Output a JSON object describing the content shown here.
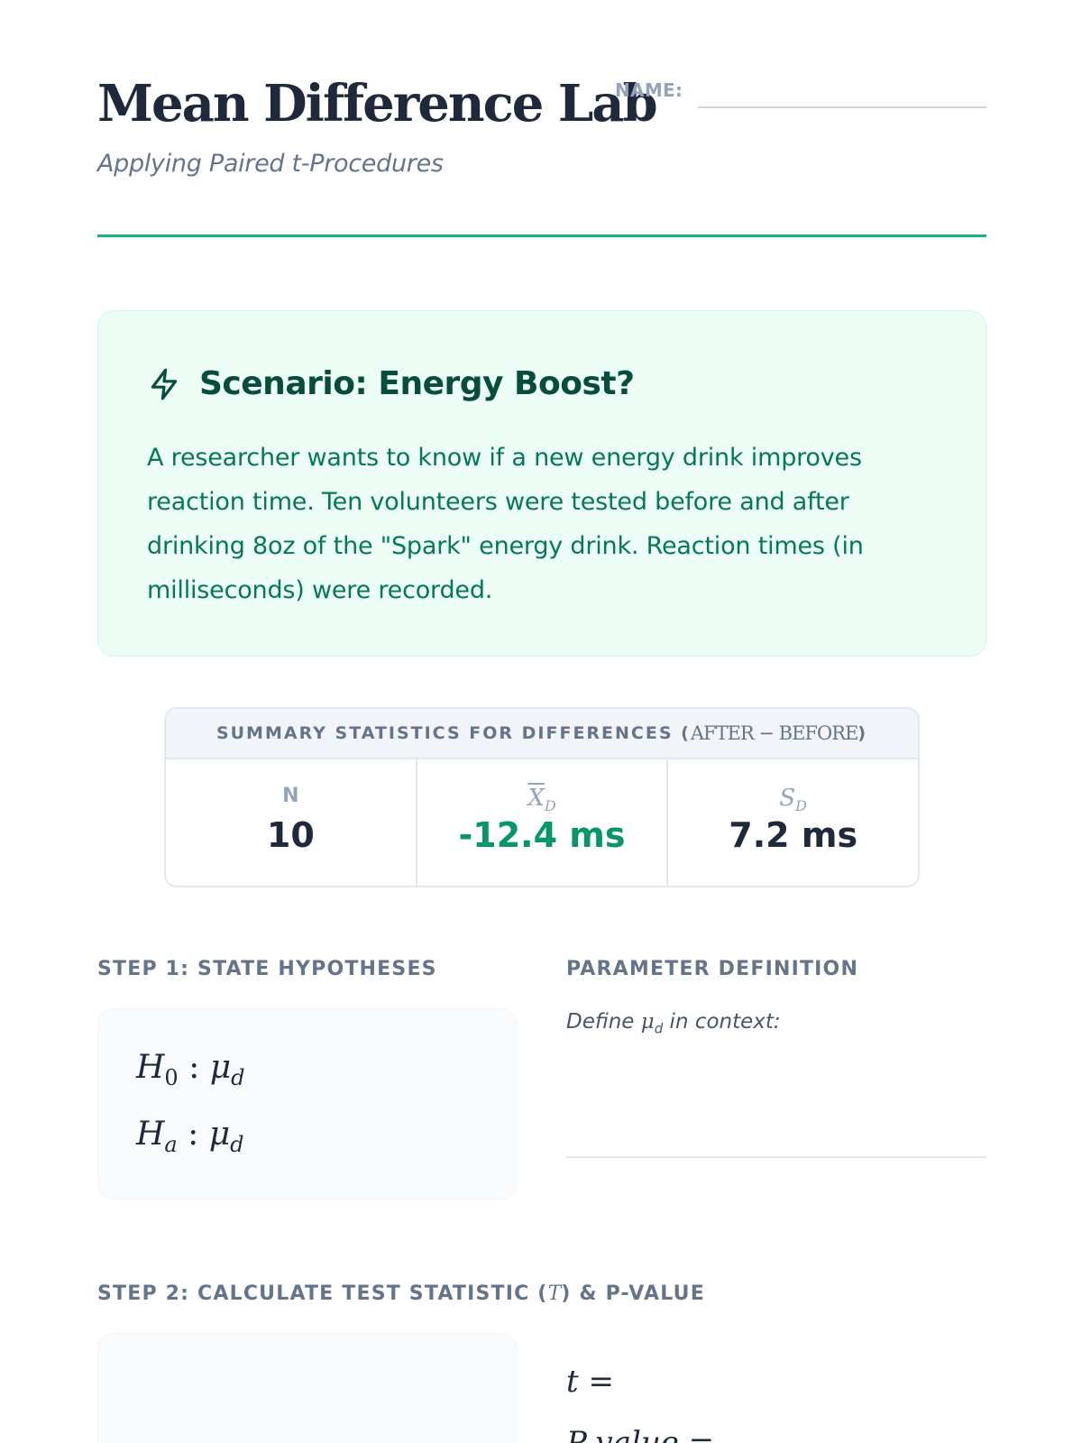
{
  "header": {
    "title": "Mean Difference Lab",
    "name_label": "NAME:",
    "subtitle": "Applying Paired t-Procedures"
  },
  "scenario": {
    "icon": "bolt-icon",
    "title": "Scenario: Energy Boost?",
    "text": "A researcher wants to know if a new energy drink improves reaction time. Ten volunteers were tested before and after drinking 8oz of the \"Spark\" energy drink. Reaction times (in milliseconds) were recorded."
  },
  "summary": {
    "heading": "SUMMARY STATISTICS FOR DIFFERENCES (",
    "heading_math": "AFTER − BEFORE",
    "heading_close": ")",
    "stats": [
      {
        "label": "N",
        "value": "10"
      },
      {
        "label": "X",
        "label_sub": "D",
        "value": "-12.4 ms"
      },
      {
        "label": "S",
        "label_sub": "D",
        "value": "7.2 ms"
      }
    ]
  },
  "step1": {
    "label": "STEP 1: STATE HYPOTHESES",
    "h0_var": "H",
    "h0_sub": "0",
    "ha_var": "H",
    "ha_sub": "a",
    "colon": ":",
    "mu": "μ",
    "mu_sub": "d"
  },
  "parameter": {
    "label": "PARAMETER DEFINITION",
    "prompt_pre": "Define ",
    "prompt_mu": "μ",
    "prompt_sub": "d",
    "prompt_post": " in context:"
  },
  "step2": {
    "label_pre": "STEP 2: CALCULATE TEST STATISTIC (",
    "label_math": "T",
    "label_post": ") & P-VALUE",
    "t_expr": "t =",
    "p_expr": "P-value ="
  },
  "colors": {
    "accent": "#10b981",
    "scenario_bg": "#ecfdf5",
    "scenario_title": "#064e3b",
    "scenario_text": "#047857",
    "mean_value": "#059669",
    "label_gray": "#64748b"
  }
}
